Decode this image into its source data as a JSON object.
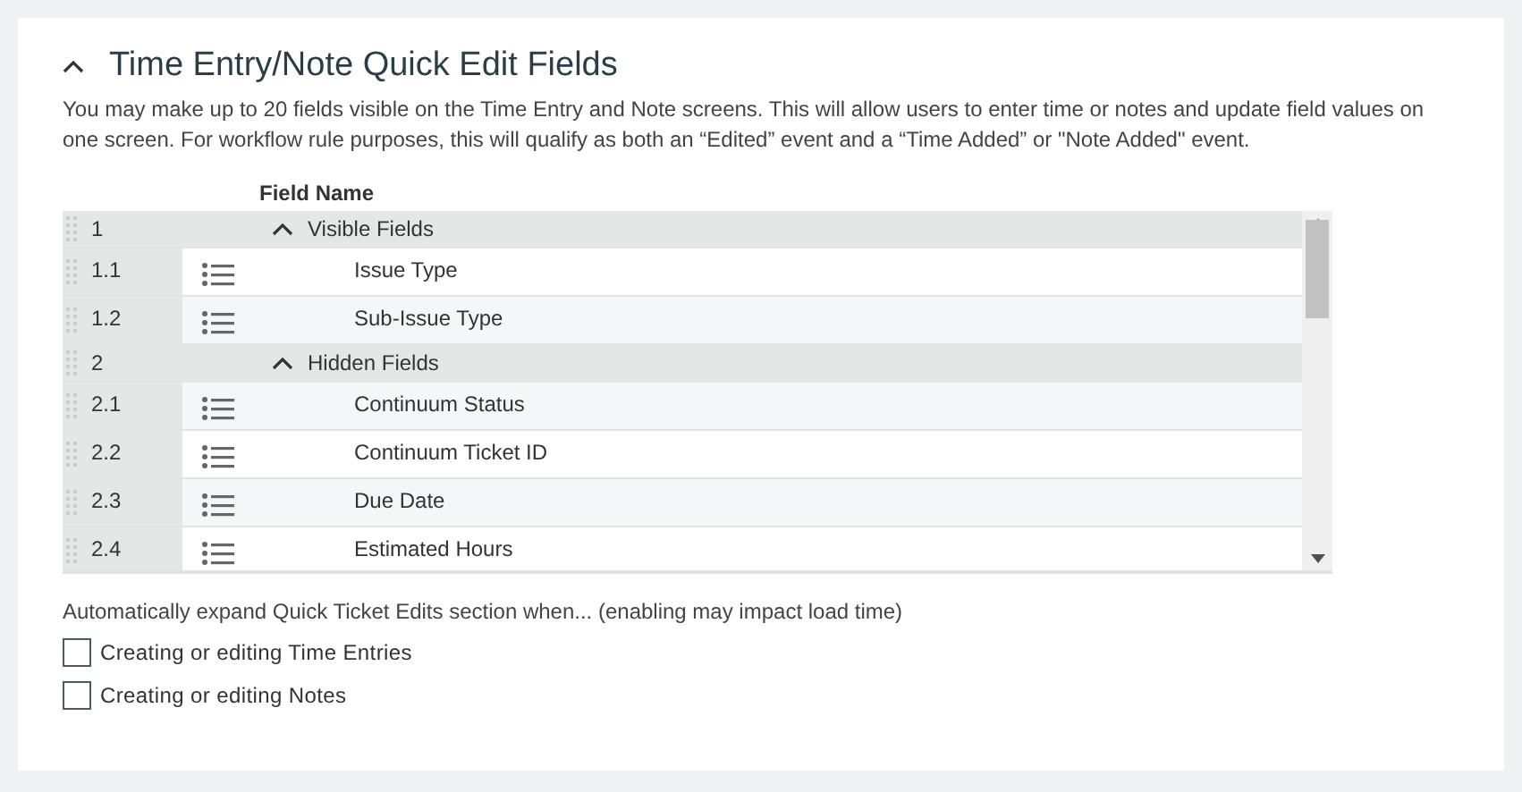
{
  "section": {
    "title": "Time Entry/Note Quick Edit Fields",
    "expanded": true,
    "description": "You may make up to 20 fields visible on the Time Entry and Note screens. This will allow users to enter time or notes and update field values on one screen. For workflow rule purposes, this will qualify as both an “Edited” event and a “Time Added” or \"Note Added\" event."
  },
  "table": {
    "columns": [
      "Field Name"
    ],
    "groups": [
      {
        "number": "1",
        "label": "Visible Fields",
        "expanded": true,
        "children": [
          {
            "number": "1.1",
            "name": "Issue Type"
          },
          {
            "number": "1.2",
            "name": "Sub-Issue Type"
          }
        ]
      },
      {
        "number": "2",
        "label": "Hidden Fields",
        "expanded": true,
        "children": [
          {
            "number": "2.1",
            "name": "Continuum Status"
          },
          {
            "number": "2.2",
            "name": "Continuum Ticket ID"
          },
          {
            "number": "2.3",
            "name": "Due Date"
          },
          {
            "number": "2.4",
            "name": "Estimated Hours"
          }
        ]
      }
    ]
  },
  "auto_expand": {
    "label": "Automatically expand Quick Ticket Edits section when... (enabling may impact load time)",
    "options": [
      {
        "label": "Creating or editing Time Entries",
        "checked": false
      },
      {
        "label": "Creating or editing Notes",
        "checked": false
      }
    ]
  }
}
